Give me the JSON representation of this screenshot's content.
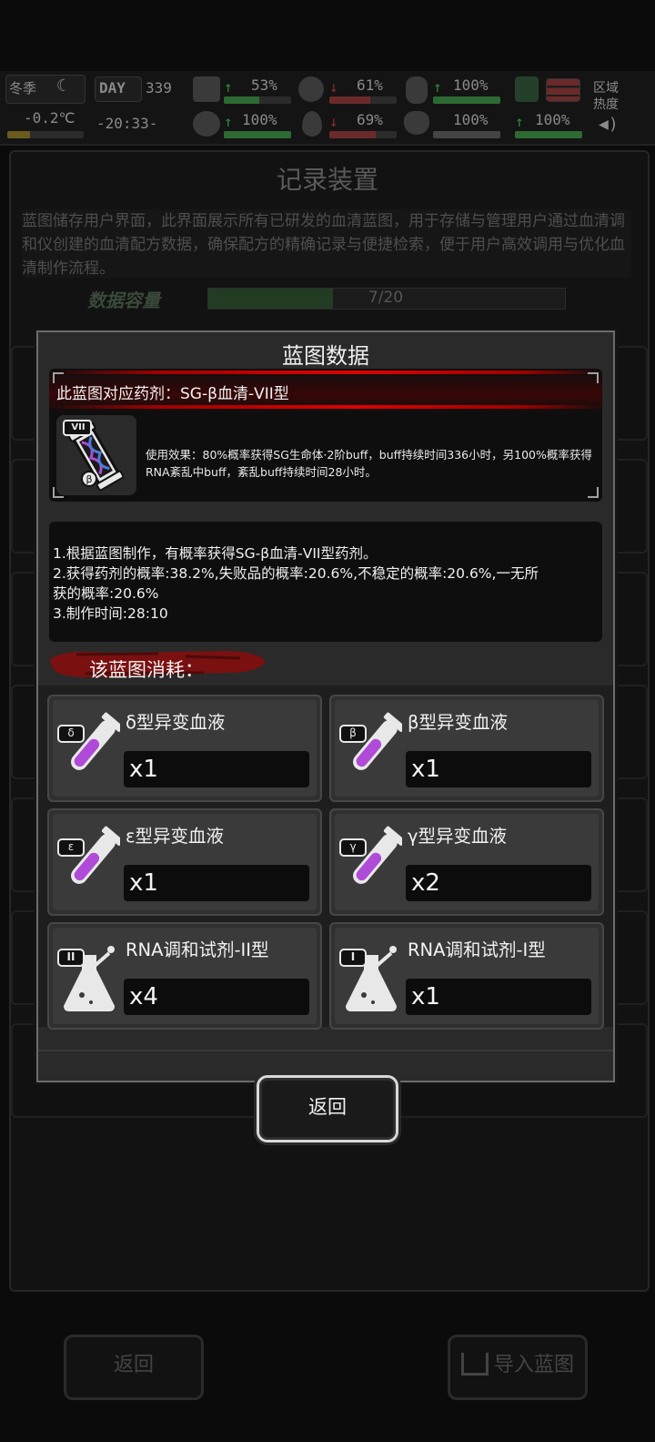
{
  "hud": {
    "season": "冬季",
    "temperature": "-0.2℃",
    "day_label": "DAY",
    "day_number": "339",
    "clock": "-20:33-",
    "stats": [
      {
        "name": "health",
        "value": "53%",
        "trend": "up",
        "fraction": 0.53
      },
      {
        "name": "hunger",
        "value": "61%",
        "trend": "down",
        "fraction": 0.61
      },
      {
        "name": "fatigue",
        "value": "100%",
        "trend": "up",
        "fraction": 1.0
      },
      {
        "name": "mental",
        "value": "100%",
        "trend": "up",
        "fraction": 1.0
      },
      {
        "name": "thirst",
        "value": "69%",
        "trend": "down",
        "fraction": 0.69
      },
      {
        "name": "mood",
        "value": "100%",
        "trend": "none",
        "fraction": 1.0
      },
      {
        "name": "virus",
        "value": "100%",
        "trend": "up",
        "fraction": 1.0
      }
    ],
    "region_heat_label": "区域热度"
  },
  "background": {
    "title": "记录装置",
    "description": "蓝图储存用户界面，此界面展示所有已研发的血清蓝图，用于存储与管理用户通过血清调和仪创建的血清配方数据，确保配方的精确记录与便捷检索，便于用户高效调用与优化血清制作流程。",
    "capacity_label": "数据容量",
    "capacity_value": "7/20",
    "capacity_fraction": 0.35,
    "return_label": "返回",
    "import_label": "导入蓝图"
  },
  "modal": {
    "title": "蓝图数据",
    "heading": "此蓝图对应药剂：SG-β血清-VII型",
    "item_badge": "VII",
    "effect_text": "使用效果：80%概率获得SG生命体·2阶buff，buff持续时间336小时，另100%概率获得RNA紊乱中buff，紊乱buff持续时间28小时。",
    "desc_lines": [
      "1.根据蓝图制作，有概率获得SG-β血清-VII型药剂。",
      "2.获得药剂的概率:38.2%,失败品的概率:20.6%,不稳定的概率:20.6%,一无所",
      "获的概率:20.6%",
      "3.制作时间:28:10"
    ],
    "cost_label": "该蓝图消耗：",
    "materials": [
      {
        "name": "δ型异变血液",
        "qty": "x1",
        "badge": "δ",
        "icon": "test-tube-icon"
      },
      {
        "name": "β型异变血液",
        "qty": "x1",
        "badge": "β",
        "icon": "test-tube-icon"
      },
      {
        "name": "ε型异变血液",
        "qty": "x1",
        "badge": "ε",
        "icon": "test-tube-icon"
      },
      {
        "name": "γ型异变血液",
        "qty": "x2",
        "badge": "γ",
        "icon": "test-tube-icon"
      },
      {
        "name": "RNA调和试剂-II型",
        "qty": "x4",
        "badge": "II",
        "icon": "flask-icon"
      },
      {
        "name": "RNA调和试剂-I型",
        "qty": "x1",
        "badge": "I",
        "icon": "flask-icon"
      }
    ],
    "return_label": "返回"
  },
  "colors": {
    "accent_red": "#e00000",
    "serum_purple": "#b04ad8",
    "modal_bg": "#2a2a2a",
    "hud_green": "#2d6a33"
  }
}
